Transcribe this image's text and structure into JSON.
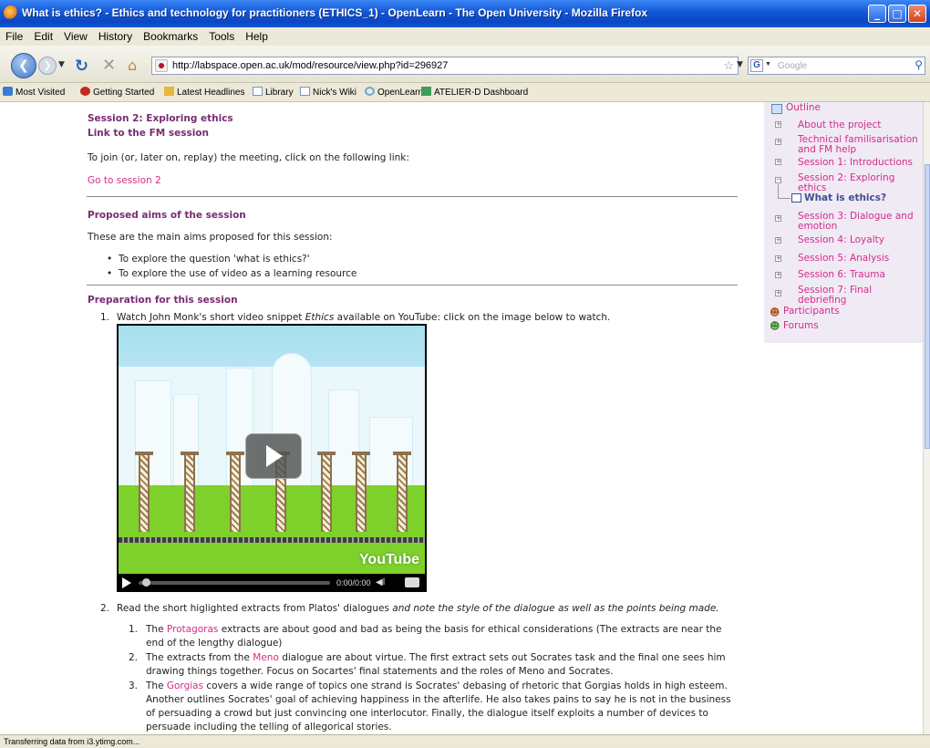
{
  "window": {
    "title": "What is ethics? - Ethics and technology for practitioners (ETHICS_1) - OpenLearn - The Open University - Mozilla Firefox"
  },
  "menu": [
    "File",
    "Edit",
    "View",
    "History",
    "Bookmarks",
    "Tools",
    "Help"
  ],
  "nav": {
    "url": "http://labspace.open.ac.uk/mod/resource/view.php?id=296927",
    "search_placeholder": "Google"
  },
  "bookmarks": [
    "Most Visited",
    "Getting Started",
    "Latest Headlines",
    "Library",
    "Nick's Wiki",
    "OpenLearn",
    "ATELIER-D Dashboard"
  ],
  "page": {
    "session_title": "Session 2: Exploring ethics",
    "fm_link_heading": "Link to the FM session",
    "join_text": "To join (or, later on, replay) the meeting, click on the following link:",
    "go_link": "Go to session 2",
    "aims_heading": "Proposed aims of the session",
    "aims_intro": "These are the main aims proposed for this session:",
    "aims": [
      "To explore the question 'what is ethics?'",
      "To explore the use of video as a learning resource"
    ],
    "prep_heading": "Preparation for this session",
    "step1_pre": "Watch John Monk's short video snippet ",
    "step1_em": "Ethics",
    "step1_post": " available on YouTube: click on the image below to watch.",
    "step2_pre": "Read the short higlighted extracts from Platos' dialogues ",
    "step2_em": "and note the style of the dialogue as well as the points being made.",
    "video": {
      "time": "0:00/0:00",
      "logo": "YouTube",
      "progress": 0
    },
    "extracts": [
      {
        "num": "1.",
        "lines": [
          [
            "The ",
            "Protagoras",
            " extracts are about good and bad as being the basis for ethical considerations (The extracts are near the"
          ],
          [
            "end of the lengthy dialogue)"
          ]
        ]
      },
      {
        "num": "2.",
        "lines": [
          [
            "The extracts from the ",
            "Meno",
            " dialogue are about virtue. The first extract sets out Socrates task and the final one sees him"
          ],
          [
            "drawing things together. Focus on Socartes' final statements and the roles of Meno and Socrates."
          ]
        ]
      },
      {
        "num": "3.",
        "lines": [
          [
            "The ",
            "Gorgias",
            " covers a wide range of topics one strand is Socrates' debasing of rhetoric that Gorgias holds in high esteem."
          ],
          [
            "Another outlines Socrates' goal of achieving happiness in the afterlife. He also takes pains to say he is not in the business"
          ],
          [
            "of persuading a crowd but just convincing one interlocutor. Finally, the dialogue itself exploits a number of devices to"
          ],
          [
            "persuade including the telling of allegorical stories."
          ]
        ]
      }
    ]
  },
  "sidebar": {
    "outline_label": "Outline",
    "items": [
      {
        "label": "About the project",
        "lines": [
          "About the project"
        ]
      },
      {
        "label": "Technical familisarisation and FM help",
        "lines": [
          "Technical familisarisation",
          "and FM help"
        ]
      },
      {
        "label": "Session 1: Introductions",
        "lines": [
          "Session 1: Introductions"
        ]
      },
      {
        "label": "Session 2: Exploring ethics",
        "lines": [
          "Session 2: Exploring",
          "ethics"
        ]
      },
      {
        "label": "Session 3: Dialogue and emotion",
        "lines": [
          "Session 3: Dialogue and",
          "emotion"
        ]
      },
      {
        "label": "Session 4: Loyalty",
        "lines": [
          "Session 4: Loyalty"
        ]
      },
      {
        "label": "Session 5: Analysis",
        "lines": [
          "Session 5: Analysis"
        ]
      },
      {
        "label": "Session 6: Trauma",
        "lines": [
          "Session 6: Trauma"
        ]
      },
      {
        "label": "Session 7: Final debriefing",
        "lines": [
          "Session 7: Final",
          "debriefing"
        ]
      }
    ],
    "current_page": "What is ethics?",
    "participants": "Participants",
    "forums": "Forums"
  },
  "status": "Transferring data from i3.ytimg.com...",
  "colors": {
    "heading_purple": "#7a2b73",
    "link_pink": "#d42c8a",
    "sidebar_bg": "#f0eaf5",
    "titlebar_blue": "#1257d6"
  }
}
